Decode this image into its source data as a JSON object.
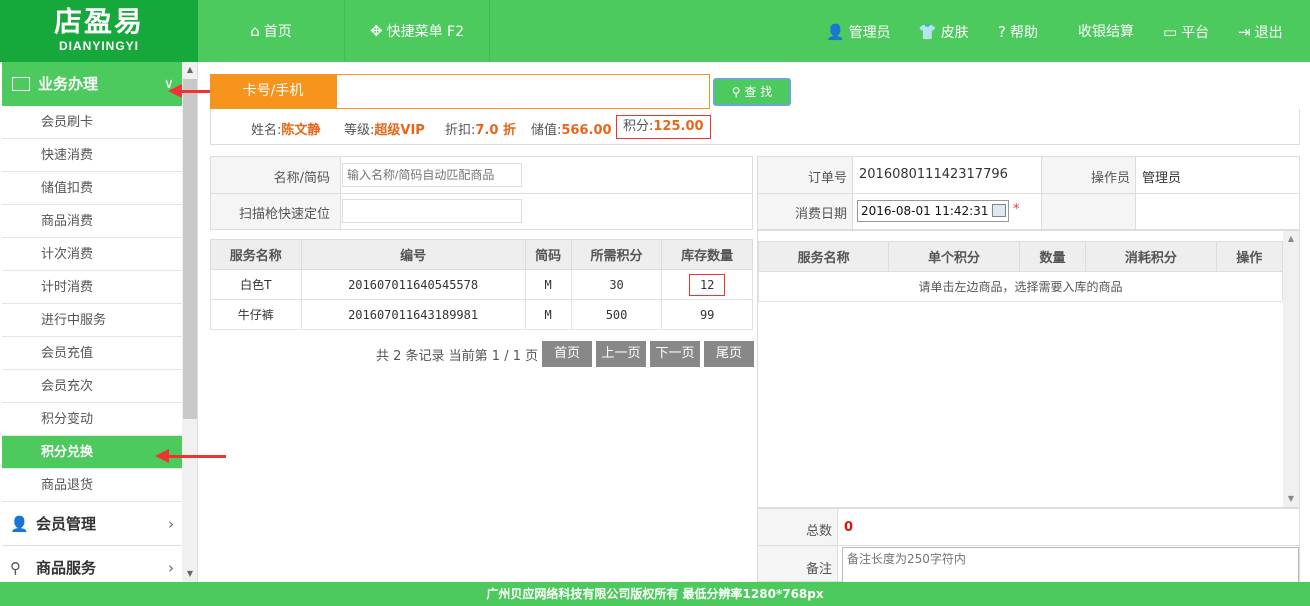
{
  "logo": {
    "title": "店盈易",
    "subtitle": "DIANYINGYI"
  },
  "top_nav": {
    "home": "首页",
    "quick_menu": "快捷菜单 F2",
    "admin": "管理员",
    "skin": "皮肤",
    "help": "帮助",
    "cashier": "收银结算",
    "platform": "平台",
    "logout": "退出"
  },
  "sidebar": {
    "section1": "业务办理",
    "items": [
      "会员刷卡",
      "快速消费",
      "储值扣费",
      "商品消费",
      "计次消费",
      "计时消费",
      "进行中服务",
      "会员充值",
      "会员充次",
      "积分变动",
      "积分兑换",
      "商品退货"
    ],
    "active_index": 10,
    "section2": "会员管理",
    "section3": "商品服务"
  },
  "search": {
    "label": "卡号/手机",
    "value": "",
    "button": "查 找"
  },
  "member": {
    "name_label": "姓名:",
    "name": "陈文静",
    "level_label": "等级:",
    "level": "超级VIP",
    "discount_label": "折扣:",
    "discount": "7.0 折",
    "balance_label": "储值:",
    "balance": "566.00",
    "points_label": "积分:",
    "points": "125.00"
  },
  "form": {
    "name_label": "名称/简码",
    "name_placeholder": "输入名称/简码自动匹配商品",
    "scan_label": "扫描枪快速定位",
    "scan_value": ""
  },
  "goods_table": {
    "headers": [
      "服务名称",
      "编号",
      "简码",
      "所需积分",
      "库存数量"
    ],
    "rows": [
      [
        "白色T",
        "201607011640545578",
        "M",
        "30",
        "12"
      ],
      [
        "牛仔裤",
        "201607011643189981",
        "M",
        "500",
        "99"
      ]
    ]
  },
  "pager": {
    "summary": "共 2 条记录 当前第 1 / 1 页",
    "first": "首页",
    "prev": "上一页",
    "next": "下一页",
    "last": "尾页"
  },
  "order": {
    "order_label": "订单号",
    "order_no": "201608011142317796",
    "operator_label": "操作员",
    "operator": "管理员",
    "date_label": "消费日期",
    "date": "2016-08-01 11:42:31",
    "required": "*"
  },
  "cart_table": {
    "headers": [
      "服务名称",
      "单个积分",
      "数量",
      "消耗积分",
      "操作"
    ],
    "empty": "请单击左边商品，选择需要入库的商品"
  },
  "totals": {
    "total_label": "总数",
    "total": "0",
    "note_label": "备注",
    "note_placeholder": "备注长度为250字符内"
  },
  "footer": "广州贝应网络科技有限公司版权所有 最低分辨率1280*768px",
  "colors": {
    "brand": "#4cca5d",
    "dark_brand": "#16a83a",
    "accent": "#f7941d",
    "red": "#e33333"
  }
}
